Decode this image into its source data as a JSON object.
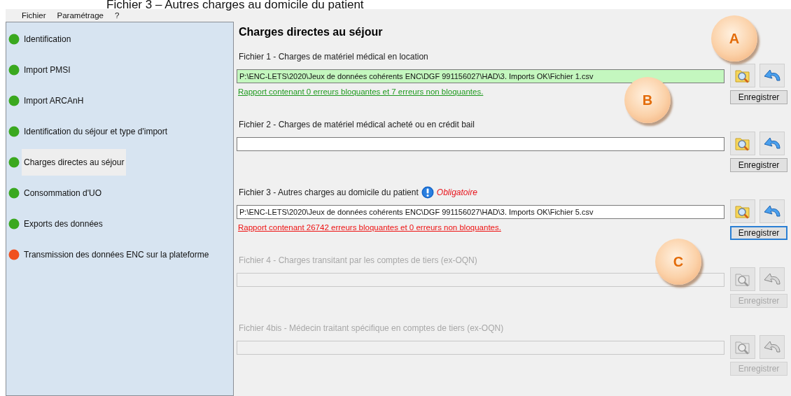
{
  "caption": "Fichier 3 – Autres charges au domicile du patient",
  "menu": [
    "Fichier",
    "Paramétrage",
    "?"
  ],
  "sidebar": {
    "items": [
      {
        "label": "Identification",
        "color": "#3aa81f",
        "selected": false
      },
      {
        "label": "Import PMSI",
        "color": "#3aa81f",
        "selected": false
      },
      {
        "label": "Import ARCAnH",
        "color": "#3aa81f",
        "selected": false
      },
      {
        "label": "Identification du séjour et type d'import",
        "color": "#3aa81f",
        "selected": false
      },
      {
        "label": "Charges directes au séjour",
        "color": "#3aa81f",
        "selected": true
      },
      {
        "label": "Consommation d'UO",
        "color": "#3aa81f",
        "selected": false
      },
      {
        "label": "Exports des données",
        "color": "#3aa81f",
        "selected": false
      },
      {
        "label": "Transmission des données ENC sur la plateforme",
        "color": "#f0501e",
        "selected": false
      }
    ]
  },
  "section_title": "Charges directes au séjour",
  "files": [
    {
      "label": "Fichier 1 - Charges de matériel médical en location",
      "value": "P:\\ENC-LETS\\2020\\Jeux de données cohérents ENC\\DGF 991156027\\HAD\\3. Imports OK\\Fichier 1.csv",
      "valid": true,
      "report": "Rapport contenant 0 erreurs bloquantes et 7 erreurs non bloquantes.",
      "report_error": false,
      "disabled": false,
      "focused": false,
      "button": "Enregistrer"
    },
    {
      "label": "Fichier 2 - Charges de matériel médical acheté ou en crédit bail",
      "valid": false,
      "disabled": false,
      "focused": false,
      "button": "Enregistrer"
    },
    {
      "label": "Fichier 3 - Autres charges au domicile du patient",
      "required": "Obligatoire",
      "value": "P:\\ENC-LETS\\2020\\Jeux de données cohérents ENC\\DGF 991156027\\HAD\\3. Imports OK\\Fichier 5.csv",
      "valid": false,
      "report": "Rapport contenant 26742 erreurs bloquantes et 0 erreurs non bloquantes.",
      "report_error": true,
      "disabled": false,
      "focused": true,
      "button": "Enregistrer"
    },
    {
      "label": "Fichier 4 - Charges transitant par les comptes de tiers (ex-OQN)",
      "valid": false,
      "disabled": true,
      "focused": false,
      "button": "Enregistrer"
    },
    {
      "label": "Fichier 4bis - Médecin traitant spécifique en comptes de tiers (ex-OQN)",
      "valid": false,
      "disabled": true,
      "focused": false,
      "button": "Enregistrer"
    }
  ],
  "callouts": [
    {
      "label": "A"
    },
    {
      "label": "B"
    },
    {
      "label": "C"
    }
  ]
}
